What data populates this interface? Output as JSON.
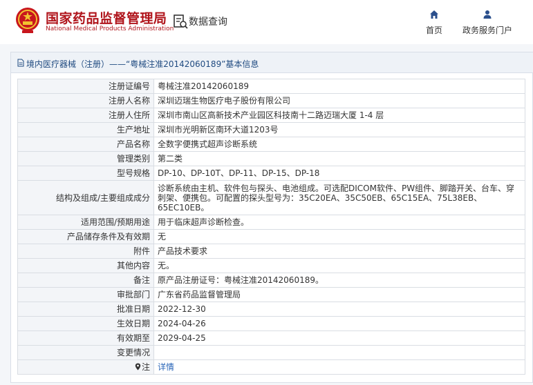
{
  "header": {
    "brand_cn": "国家药品监督管理局",
    "brand_en": "National Medical Products Administration",
    "emblem_icon": "national-emblem-icon",
    "query_icon": "data-query-icon",
    "query_label": "数据查询",
    "nav": [
      {
        "label": "首页",
        "icon": "home-icon"
      },
      {
        "label": "政务服务门户",
        "icon": "user-icon"
      }
    ]
  },
  "breadcrumb": {
    "text": "境内医疗器械（注册）——“粤械注准20142060189”基本信息",
    "icon": "document-icon"
  },
  "rows": [
    {
      "key": "注册证编号",
      "value": "粤械注准20142060189"
    },
    {
      "key": "注册人名称",
      "value": "深圳迈瑞生物医疗电子股份有限公司"
    },
    {
      "key": "注册人住所",
      "value": "深圳市南山区高新技术产业园区科技南十二路迈瑞大厦 1-4 层"
    },
    {
      "key": "生产地址",
      "value": "深圳市光明新区南环大道1203号"
    },
    {
      "key": "产品名称",
      "value": "全数字便携式超声诊断系统"
    },
    {
      "key": "管理类别",
      "value": "第二类"
    },
    {
      "key": "型号规格",
      "value": "DP-10、DP-10T、DP-11、DP-15、DP-18"
    },
    {
      "key": "结构及组成/主要组成成分",
      "value": "诊断系统由主机、软件包与探头、电池组成。可选配DICOM软件、PW组件、脚踏开关、台车、穿刺架、便携包。可配置的探头型号为：35C20EA、35C50EB、65C15EA、75L38EB、65EC10EB。"
    },
    {
      "key": "适用范围/预期用途",
      "value": "用于临床超声诊断检查。"
    },
    {
      "key": "产品储存条件及有效期",
      "value": "无"
    },
    {
      "key": "附件",
      "value": "产品技术要求"
    },
    {
      "key": "其他内容",
      "value": "无。"
    },
    {
      "key": "备注",
      "value": "原产品注册证号：粤械注准20142060189。"
    },
    {
      "key": "审批部门",
      "value": "广东省药品监督管理局"
    },
    {
      "key": "批准日期",
      "value": "2022-12-30"
    },
    {
      "key": "生效日期",
      "value": "2024-04-26"
    },
    {
      "key": "有效期至",
      "value": "2029-04-25"
    },
    {
      "key": "变更情况",
      "value": ""
    }
  ],
  "note_row": {
    "key": "注",
    "value": "详情",
    "icon": "info-pin-icon"
  },
  "colors": {
    "brand_red": "#b0141b",
    "link_blue": "#2a66b8",
    "crumb_blue": "#1f4a80"
  }
}
